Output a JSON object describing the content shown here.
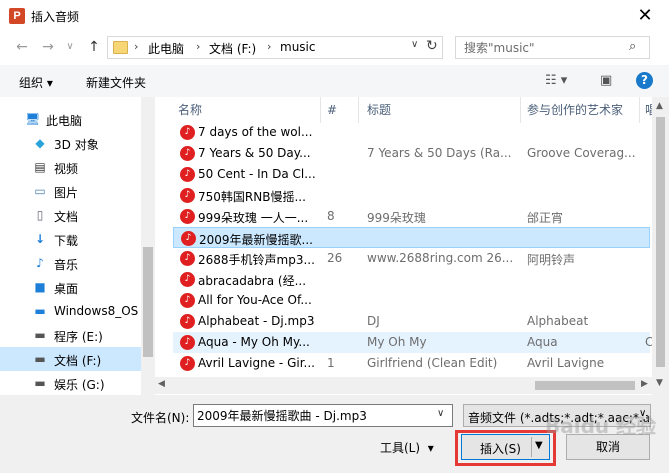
{
  "window": {
    "title": "插入音频",
    "app_icon_letter": "P",
    "close": "✕"
  },
  "nav": {
    "back": "←",
    "forward": "→",
    "recent": "∨",
    "up": "↑",
    "breadcrumbs": [
      "此电脑",
      "文档 (F:)",
      "music"
    ],
    "search_placeholder": "搜索\"music\""
  },
  "toolbar": {
    "organize": "组织 ▾",
    "new_folder": "新建文件夹",
    "help": "?"
  },
  "sidebar": {
    "items": [
      {
        "label": "此电脑",
        "icon": "computer-icon"
      },
      {
        "label": "3D 对象",
        "icon": "cube-icon"
      },
      {
        "label": "视频",
        "icon": "video-icon"
      },
      {
        "label": "图片",
        "icon": "picture-icon"
      },
      {
        "label": "文档",
        "icon": "document-icon"
      },
      {
        "label": "下载",
        "icon": "download-icon"
      },
      {
        "label": "音乐",
        "icon": "music-icon"
      },
      {
        "label": "桌面",
        "icon": "desktop-icon"
      },
      {
        "label": "Windows8_OS",
        "icon": "drive-icon"
      },
      {
        "label": "程序 (E:)",
        "icon": "drive-icon"
      },
      {
        "label": "文档 (F:)",
        "icon": "drive-icon"
      },
      {
        "label": "娱乐 (G:)",
        "icon": "drive-icon"
      }
    ],
    "selected_index": 10
  },
  "columns": [
    "名称",
    "#",
    "标题",
    "参与创作的艺术家",
    "唱"
  ],
  "files": [
    {
      "name": "7 days of the wol...",
      "num": "",
      "title": "",
      "artist": "",
      "extra": ""
    },
    {
      "name": "7 Years & 50 Day...",
      "num": "",
      "title": "7 Years & 50 Days (Ra...",
      "artist": "Groove Coverag...",
      "extra": ""
    },
    {
      "name": "50 Cent - In Da Cl...",
      "num": "",
      "title": "",
      "artist": "",
      "extra": ""
    },
    {
      "name": "750韩国RNB慢摇...",
      "num": "",
      "title": "",
      "artist": "",
      "extra": ""
    },
    {
      "name": "999朵玫瑰 一人一...",
      "num": "8",
      "title": "999朵玫瑰",
      "artist": "邰正宵",
      "extra": ""
    },
    {
      "name": "2009年最新慢摇歌...",
      "num": "",
      "title": "",
      "artist": "",
      "extra": ""
    },
    {
      "name": "2688手机铃声mp3...",
      "num": "26",
      "title": "www.2688ring.com 26...",
      "artist": "阿明铃声",
      "extra": ""
    },
    {
      "name": "abracadabra (经...",
      "num": "",
      "title": "",
      "artist": "",
      "extra": ""
    },
    {
      "name": "All for You-Ace Of...",
      "num": "",
      "title": "",
      "artist": "",
      "extra": ""
    },
    {
      "name": "Alphabeat - Dj.mp3",
      "num": "",
      "title": "DJ",
      "artist": "Alphabeat",
      "extra": ""
    },
    {
      "name": "Aqua - My Oh My...",
      "num": "",
      "title": "My Oh My",
      "artist": "Aqua",
      "extra": "C"
    },
    {
      "name": "Avril Lavigne - Gir...",
      "num": "1",
      "title": "Girlfriend (Clean Edit)",
      "artist": "Avril Lavigne",
      "extra": ""
    }
  ],
  "selected_file_index": 5,
  "hover_file_index": 10,
  "bottom": {
    "filename_label": "文件名(N):",
    "filename_value": "2009年最新慢摇歌曲 - Dj.mp3",
    "filetype_value": "音频文件 (*.adts;*.adt;*.aac;*.aif",
    "tools": "工具(L)",
    "tools_arrow": "▾",
    "insert": "插入(S)",
    "cancel": "取消"
  },
  "watermark": "Baidu 经验",
  "colors": {
    "selection": "#cce8ff",
    "highlight": "#e53935",
    "accent": "#0078d7"
  }
}
